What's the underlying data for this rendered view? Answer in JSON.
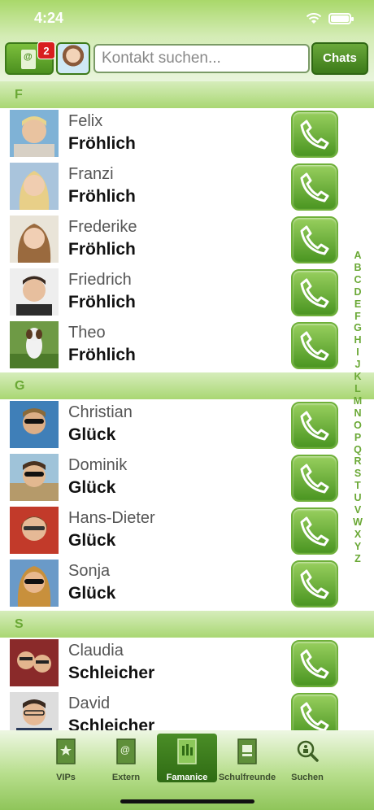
{
  "status_bar": {
    "time": "4:24"
  },
  "toolbar": {
    "extern_badge": "2",
    "search_placeholder": "Kontakt suchen...",
    "chats_label": "Chats"
  },
  "sections": [
    {
      "letter": "F",
      "contacts": [
        {
          "first": "Felix",
          "last": "Fröhlich"
        },
        {
          "first": "Franzi",
          "last": "Fröhlich"
        },
        {
          "first": "Frederike",
          "last": "Fröhlich"
        },
        {
          "first": "Friedrich",
          "last": "Fröhlich"
        },
        {
          "first": "Theo",
          "last": "Fröhlich"
        }
      ]
    },
    {
      "letter": "G",
      "contacts": [
        {
          "first": "Christian",
          "last": "Glück"
        },
        {
          "first": "Dominik",
          "last": "Glück"
        },
        {
          "first": "Hans-Dieter",
          "last": "Glück"
        },
        {
          "first": "Sonja",
          "last": "Glück"
        }
      ]
    },
    {
      "letter": "S",
      "contacts": [
        {
          "first": "Claudia",
          "last": "Schleicher"
        },
        {
          "first": "David",
          "last": "Schleicher"
        }
      ]
    }
  ],
  "index_letters": [
    "A",
    "B",
    "C",
    "D",
    "E",
    "F",
    "G",
    "H",
    "I",
    "J",
    "K",
    "L",
    "M",
    "N",
    "O",
    "P",
    "Q",
    "R",
    "S",
    "T",
    "U",
    "V",
    "W",
    "X",
    "Y",
    "Z"
  ],
  "tabs": [
    {
      "label": "VIPs",
      "icon": "star-door-icon",
      "active": false
    },
    {
      "label": "Extern",
      "icon": "at-door-icon",
      "active": false
    },
    {
      "label": "Famanice",
      "icon": "family-door-icon",
      "active": true
    },
    {
      "label": "Schulfreunde",
      "icon": "school-door-icon",
      "active": false
    },
    {
      "label": "Suchen",
      "icon": "search-people-icon",
      "active": false
    }
  ],
  "colors": {
    "accent": "#6aa835",
    "tab_active": "#3c7a19",
    "badge": "#d81f1f"
  }
}
